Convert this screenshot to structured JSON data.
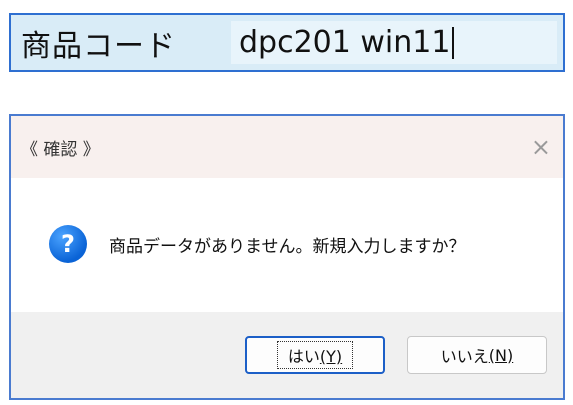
{
  "product_field": {
    "label": "商品コード",
    "value": "dpc201 win11"
  },
  "dialog": {
    "title": "《 確認 》",
    "close_glyph": "×",
    "icon": "question-icon",
    "icon_glyph": "?",
    "message": "商品データがありません。新規入力しますか？",
    "buttons": {
      "yes_text": "はい",
      "yes_key": "(Y)",
      "no_text": "いいえ",
      "no_key": "(N)"
    }
  }
}
